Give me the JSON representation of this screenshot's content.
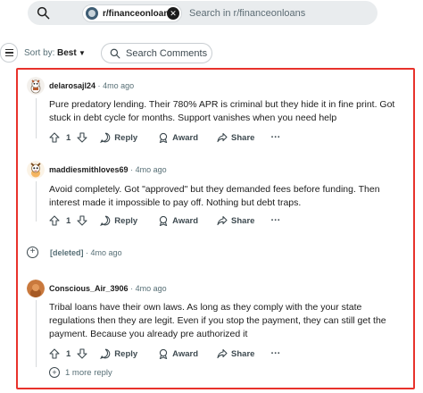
{
  "search": {
    "community_chip": "r/financeonloans",
    "placeholder": "Search in r/financeonloans"
  },
  "sort": {
    "label": "Sort by:",
    "value": "Best",
    "search_comments_label": "Search Comments"
  },
  "comments": [
    {
      "username": "delarosajl24",
      "time": "4mo ago",
      "body": "Pure predatory lending. Their 780% APR is criminal but they hide it in fine print. Got stuck in debt cycle for months. Support vanishes when you need help",
      "votes": "1",
      "reply_label": "Reply",
      "award_label": "Award",
      "share_label": "Share",
      "more_label": "···"
    },
    {
      "username": "maddiesmithloves69",
      "time": "4mo ago",
      "body": "Avoid completely. Got \"approved\" but they demanded fees before funding. Then interest made it impossible to pay off. Nothing but debt traps.",
      "votes": "1",
      "reply_label": "Reply",
      "award_label": "Award",
      "share_label": "Share",
      "more_label": "···"
    },
    {
      "username": "Conscious_Air_3906",
      "time": "4mo ago",
      "body": "Tribal loans have their own laws. As long as they comply with the your state regulations then they are legit. Even if you stop the payment, they can still get the payment. Because you already pre authorized it",
      "votes": "1",
      "reply_label": "Reply",
      "award_label": "Award",
      "share_label": "Share",
      "more_label": "···"
    }
  ],
  "deleted": {
    "label": "[deleted]",
    "time": "4mo ago"
  },
  "more_replies": "1 more reply",
  "separator": "·",
  "colors": {
    "highlight": "#e8322b",
    "search_bg": "#e9ecee",
    "text": "#1c1c1c",
    "meta": "#576f76"
  }
}
